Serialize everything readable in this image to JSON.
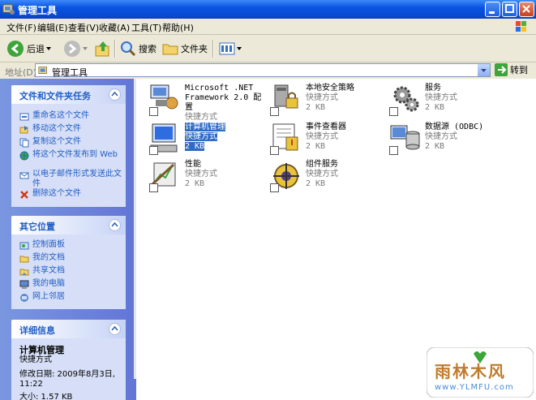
{
  "window": {
    "title": "管理工具"
  },
  "menu": [
    "文件(F)",
    "编辑(E)",
    "查看(V)",
    "收藏(A)",
    "工具(T)",
    "帮助(H)"
  ],
  "toolbar": {
    "back_label": "后退",
    "search_label": "搜索",
    "folders_label": "文件夹"
  },
  "address": {
    "label": "地址(D)",
    "value": "管理工具",
    "go_label": "转到"
  },
  "panels": {
    "tasks": {
      "title": "文件和文件夹任务",
      "items": [
        "重命名这个文件",
        "移动这个文件",
        "复制这个文件",
        "将这个文件发布到 Web",
        "以电子邮件形式发送此文件",
        "删除这个文件"
      ]
    },
    "places": {
      "title": "其它位置",
      "items": [
        "控制面板",
        "我的文档",
        "共享文档",
        "我的电脑",
        "网上邻居"
      ]
    },
    "details": {
      "title": "详细信息",
      "name": "计算机管理",
      "type": "快捷方式",
      "modified": "修改日期: 2009年8月3日, 11:22",
      "size": "大小: 1.57 KB"
    }
  },
  "files": [
    {
      "name": "Microsoft .NET Framework 2.0 配置",
      "type": "快捷方式",
      "size": "",
      "icon": "net-config-icon"
    },
    {
      "name": "本地安全策略",
      "type": "快捷方式",
      "size": "2 KB",
      "icon": "security-policy-icon"
    },
    {
      "name": "服务",
      "type": "快捷方式",
      "size": "2 KB",
      "icon": "services-icon"
    },
    {
      "name": "计算机管理",
      "type": "快捷方式",
      "size": "2 KB",
      "icon": "computer-management-icon",
      "selected": true
    },
    {
      "name": "事件查看器",
      "type": "快捷方式",
      "size": "2 KB",
      "icon": "event-viewer-icon"
    },
    {
      "name": "数据源 (ODBC)",
      "type": "快捷方式",
      "size": "2 KB",
      "icon": "odbc-icon"
    },
    {
      "name": "性能",
      "type": "快捷方式",
      "size": "2 KB",
      "icon": "performance-icon"
    },
    {
      "name": "组件服务",
      "type": "快捷方式",
      "size": "2 KB",
      "icon": "component-services-icon"
    }
  ],
  "watermark": {
    "brand": "雨林木风",
    "url": "www.YLMFU.com"
  },
  "colors": {
    "title_bar": "#0a54e3",
    "task_link": "#215dc6",
    "selection": "#316ac5"
  }
}
